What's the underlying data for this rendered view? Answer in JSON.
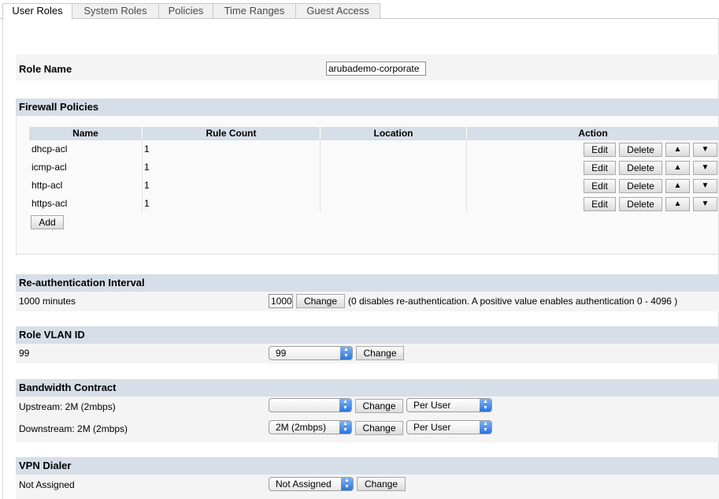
{
  "tabs": [
    {
      "label": "User Roles"
    },
    {
      "label": "System Roles"
    },
    {
      "label": "Policies"
    },
    {
      "label": "Time Ranges"
    },
    {
      "label": "Guest Access"
    }
  ],
  "role_name": {
    "label": "Role Name",
    "value": "arubademo-corporate"
  },
  "firewall": {
    "title": "Firewall Policies",
    "columns": [
      "Name",
      "Rule Count",
      "Location",
      "Action"
    ],
    "rows": [
      {
        "name": "dhcp-acl",
        "rule_count": "1",
        "location": ""
      },
      {
        "name": "icmp-acl",
        "rule_count": "1",
        "location": ""
      },
      {
        "name": "http-acl",
        "rule_count": "1",
        "location": ""
      },
      {
        "name": "https-acl",
        "rule_count": "1",
        "location": ""
      }
    ],
    "edit_label": "Edit",
    "delete_label": "Delete",
    "up_glyph": "▲",
    "down_glyph": "▼",
    "add_label": "Add"
  },
  "reauth": {
    "title": "Re-authentication Interval",
    "current": "1000 minutes",
    "input_value": "1000",
    "change_label": "Change",
    "hint": "(0 disables re-authentication. A positive value enables authentication 0 - 4096 )"
  },
  "vlan": {
    "title": "Role VLAN ID",
    "current": "99",
    "selected": "99",
    "change_label": "Change"
  },
  "bandwidth": {
    "title": "Bandwidth Contract",
    "upstream_label": "Upstream: 2M (2mbps)",
    "upstream_selected": "",
    "upstream_scope": "Per User",
    "downstream_label": "Downstream: 2M (2mbps)",
    "downstream_selected": "2M (2mbps)",
    "downstream_scope": "Per User",
    "change_label": "Change"
  },
  "vpn": {
    "title": "VPN Dialer",
    "current": "Not Assigned",
    "selected": "Not Assigned",
    "change_label": "Change"
  },
  "colors": {
    "header_bg": "#d6dee8",
    "panel_bg": "#f4f4f4",
    "select_arrow": "#2e73d9"
  }
}
